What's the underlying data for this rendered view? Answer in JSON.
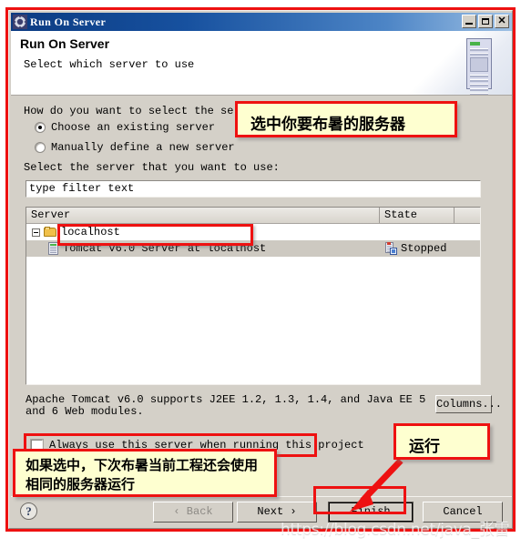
{
  "window": {
    "title": "Run On Server",
    "title_icon": "gear-icon",
    "minimize_label": "_",
    "maximize_label": "□",
    "close_label": "✕"
  },
  "header": {
    "title": "Run On Server",
    "subtitle": "Select which server to use",
    "icon": "server-tower-icon"
  },
  "main": {
    "question_label": "How do you want to select the server?",
    "radios": [
      {
        "label": "Choose an existing server",
        "selected": true
      },
      {
        "label": "Manually define a new server",
        "selected": false
      }
    ],
    "select_label": "Select the server that you want to use:",
    "filter": {
      "value": "type filter text",
      "placeholder": "type filter text"
    },
    "table": {
      "columns": [
        "Server",
        "State",
        ""
      ],
      "rows": [
        {
          "type": "group",
          "server": "localhost",
          "state": "",
          "icon": "folder-icon",
          "expander": "collapse-icon",
          "selected": false
        },
        {
          "type": "server",
          "server": "Tomcat v6.0 Server at localhost",
          "state": "Stopped",
          "icon": "server-icon",
          "state_icon": "server-stopped-icon",
          "selected": true
        }
      ]
    },
    "description": "Apache Tomcat v6.0 supports J2EE 1.2, 1.3, 1.4, and Java EE 5 and 6 Web modules.",
    "columns_button": "Columns...",
    "always_use_checkbox": {
      "label": "Always use this server when running this project",
      "checked": false
    }
  },
  "footer": {
    "help_label": "?",
    "buttons": [
      {
        "label": "‹ Back",
        "disabled": true,
        "name": "back-button"
      },
      {
        "label": "Next ›",
        "disabled": false,
        "name": "next-button"
      },
      {
        "label": "Finish",
        "disabled": false,
        "name": "finish-button"
      },
      {
        "label": "Cancel",
        "disabled": false,
        "name": "cancel-button"
      }
    ]
  },
  "annotations": {
    "top": "选中你要布暑的服务器",
    "run": "运行",
    "bottom_line1": "如果选中，下次布暑当前工程还会使用",
    "bottom_line2": "相同的服务器运行",
    "accent_color": "#ee1111",
    "callout_bg": "#feffd0"
  },
  "watermark": "https://blog.csdn.net/java_张雷"
}
